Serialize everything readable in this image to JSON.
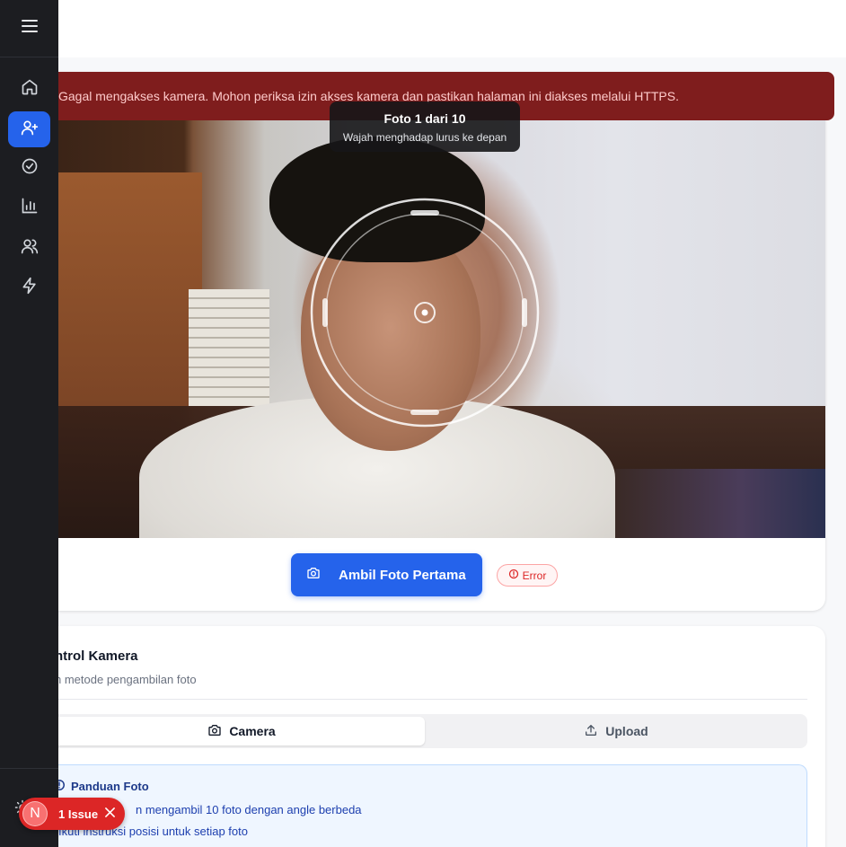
{
  "sidebar": {
    "menu_icon": "hamburger-menu-icon",
    "items": [
      {
        "icon": "home-icon",
        "active": false
      },
      {
        "icon": "user-plus-icon",
        "active": true
      },
      {
        "icon": "check-circle-icon",
        "active": false
      },
      {
        "icon": "bar-chart-icon",
        "active": false
      },
      {
        "icon": "users-icon",
        "active": false
      },
      {
        "icon": "zap-icon",
        "active": false
      }
    ]
  },
  "error_banner": {
    "message": "Gagal mengakses kamera. Mohon periksa izin akses kamera dan pastikan halaman ini diakses melalui HTTPS."
  },
  "camera": {
    "tooltip_title": "Foto 1 dari 10",
    "tooltip_instruction": "Wajah menghadap lurus ke depan"
  },
  "capture": {
    "button_label": "Ambil Foto Pertama",
    "status_badge": "Error"
  },
  "camera_control": {
    "title": "ntrol Kamera",
    "subtitle": "h metode pengambilan foto",
    "tabs": [
      {
        "label": "Camera",
        "icon": "camera-icon",
        "active": true
      },
      {
        "label": "Upload",
        "icon": "upload-icon",
        "active": false
      }
    ]
  },
  "photo_guide": {
    "title": "Panduan Foto",
    "items": [
      "n mengambil 10 foto dengan angle berbeda",
      "Ikuti instruksi posisi untuk setiap foto"
    ]
  },
  "issue_indicator": {
    "avatar_letter": "N",
    "label": "1 Issue"
  },
  "colors": {
    "accent": "#2563eb",
    "sidebar_bg": "#1c1d21",
    "error_banner_bg": "#7f1d1d",
    "error_red": "#dc2626"
  }
}
